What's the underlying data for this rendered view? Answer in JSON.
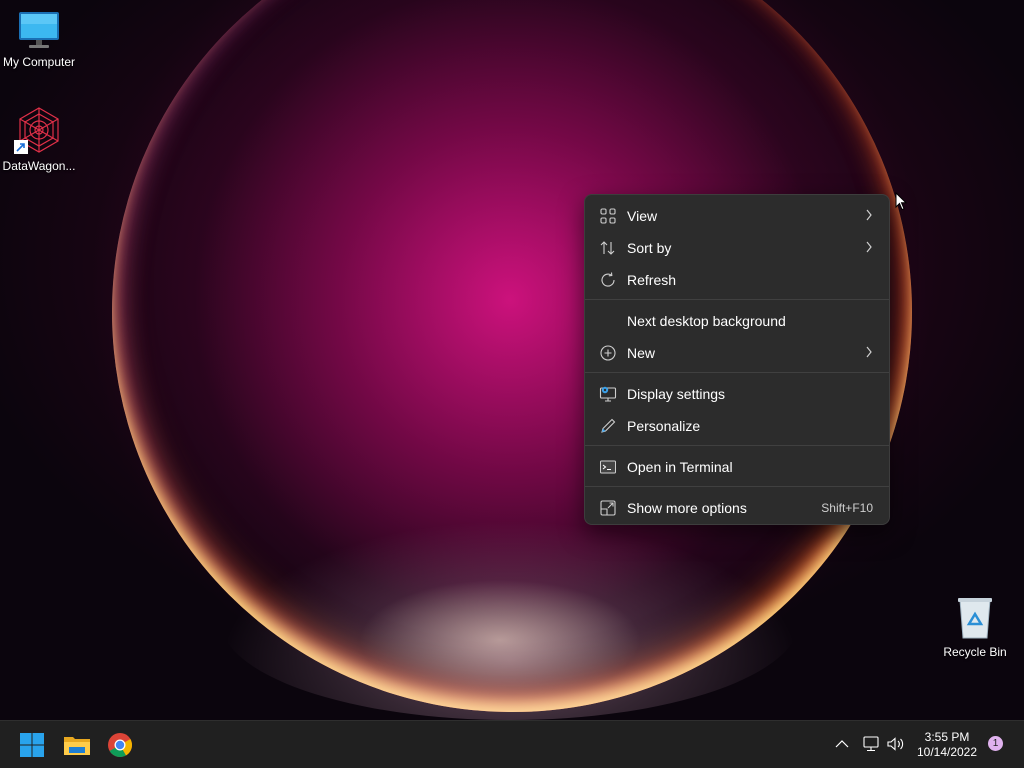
{
  "desktop": {
    "icons": [
      {
        "label": "My Computer"
      },
      {
        "label": "DataWagon..."
      },
      {
        "label": "Recycle Bin"
      }
    ]
  },
  "context_menu": {
    "items": [
      {
        "label": "View",
        "icon": "view-grid-icon"
      },
      {
        "label": "Sort by",
        "icon": "sort-icon"
      },
      {
        "label": "Refresh",
        "icon": "refresh-icon"
      },
      {
        "label": "Next desktop background"
      },
      {
        "label": "New",
        "icon": "new-plus-icon"
      },
      {
        "label": "Display settings",
        "icon": "display-settings-icon"
      },
      {
        "label": "Personalize",
        "icon": "pen-icon"
      },
      {
        "label": "Open in Terminal",
        "icon": "terminal-icon"
      },
      {
        "label": "Show more options",
        "icon": "expand-icon",
        "shortcut": "Shift+F10"
      }
    ]
  },
  "taskbar": {
    "time": "3:55 PM",
    "date": "10/14/2022",
    "notification_count": "1",
    "pinned": [
      "start-icon",
      "file-explorer-icon",
      "chrome-icon"
    ]
  },
  "colors": {
    "menu_bg": "#2c2c2c",
    "taskbar_bg": "#202020",
    "badge": "#e0b2ee",
    "windows_blue": "#29a3ec"
  }
}
